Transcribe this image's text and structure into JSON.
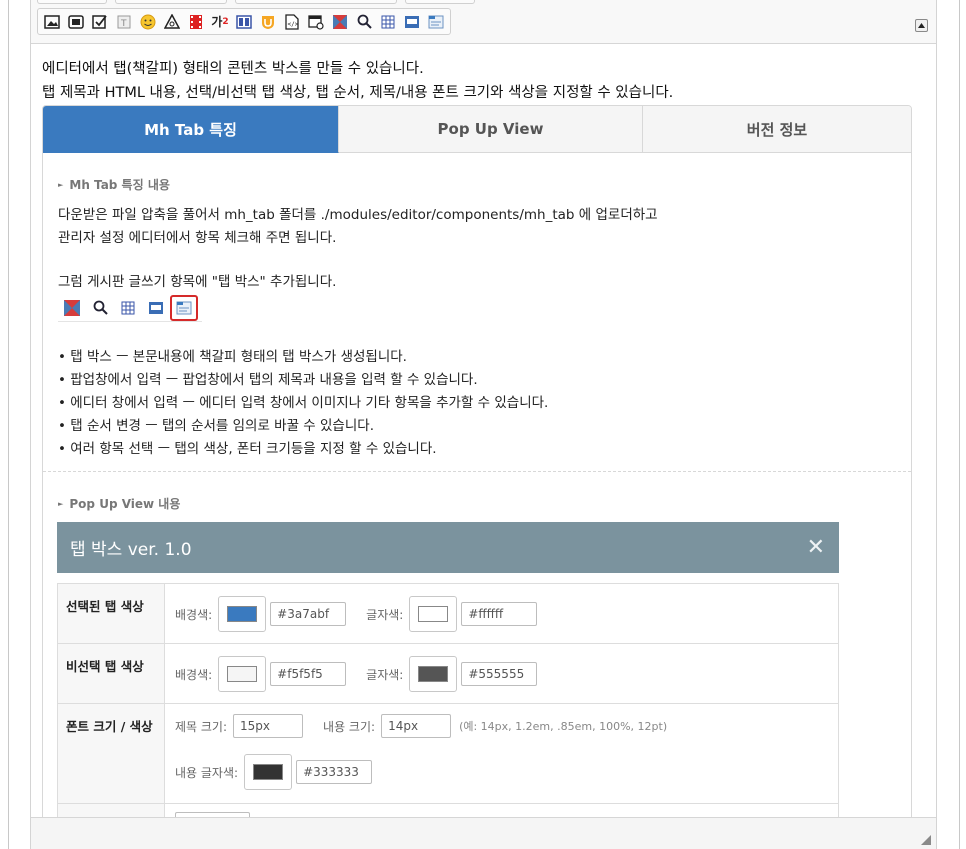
{
  "toolbar": {
    "icons": [
      "image-icon",
      "gallery-icon",
      "checkbox-icon",
      "text-box-icon",
      "emoji-icon",
      "symbol-icon",
      "film-icon",
      "superscript-icon",
      "columns-icon",
      "shield-icon",
      "source-code-icon",
      "form-icon",
      "hourglass-icon",
      "search-icon",
      "table-grid-icon",
      "media-icon",
      "tab-box-icon"
    ],
    "superscript_glyph": "가",
    "superscript_sup": "2"
  },
  "intro": {
    "line1": "에디터에서 탭(책갈피) 형태의 콘텐츠 박스를 만들 수 있습니다.",
    "line2": "탭 제목과 HTML 내용, 선택/비선택 탭 색상, 탭 순서, 제목/내용 폰트 크기와 색상을 지정할 수 있습니다."
  },
  "tabs": [
    {
      "label": "Mh Tab 특징",
      "active": true
    },
    {
      "label": "Pop Up View",
      "active": false
    },
    {
      "label": "버전 정보",
      "active": false
    }
  ],
  "colors": {
    "tab_active_bg": "#3a7abf",
    "tab_inactive_bg": "#f5f5f5",
    "popup_header": "#7b939e",
    "highlight": "#d52a2a"
  },
  "features": {
    "title": "Mh Tab 특징 내용",
    "p1_l1": "다운받은 파일 압축을 풀어서 mh_tab 폴더를 ./modules/editor/components/mh_tab 에 업로더하고",
    "p1_l2": "관리자 설정 에디터에서 항목 체크해 주면 됩니다.",
    "p2": "그럼 게시판 글쓰기 항목에 \"탭 박스\" 추가됩니다.",
    "bullets": [
      "• 탭 박스 ㅡ 본문내용에 책갈피 형태의 탭 박스가 생성됩니다.",
      "• 팝업창에서 입력 ㅡ 팝업창에서 탭의 제목과 내용을 입력 할 수 있습니다.",
      "• 에디터 창에서 입력 ㅡ 에디터 입력 창에서 이미지나 기타 항목을 추가할 수 있습니다.",
      "• 탭 순서 변경 ㅡ 탭의 순서를 임의로 바꿀 수 있습니다.",
      "• 여러 항목 선택 ㅡ 탭의 색상, 폰터 크기등을 지정 할 수 있습니다."
    ]
  },
  "popup_section": {
    "title": "Pop Up View 내용",
    "header": "탭 박스 ver. 1.0",
    "close": "✕",
    "rows": {
      "selected": {
        "label": "선택된 탭 색상",
        "bg_label": "배경색:",
        "bg_value": "#3a7abf",
        "fg_label": "글자색:",
        "fg_value": "#ffffff"
      },
      "unselected": {
        "label": "비선택 탭 색상",
        "bg_label": "배경색:",
        "bg_value": "#f5f5f5",
        "fg_label": "글자색:",
        "fg_value": "#555555"
      },
      "font": {
        "label": "폰트 크기 / 색상",
        "title_size_label": "제목 크기:",
        "title_size": "15px",
        "content_size_label": "내용 크기:",
        "content_size": "14px",
        "hint": "(예: 14px, 1.2em, .85em, 100%, 12pt)",
        "content_color_label": "내용 글자색:",
        "content_color": "#333333"
      }
    }
  }
}
